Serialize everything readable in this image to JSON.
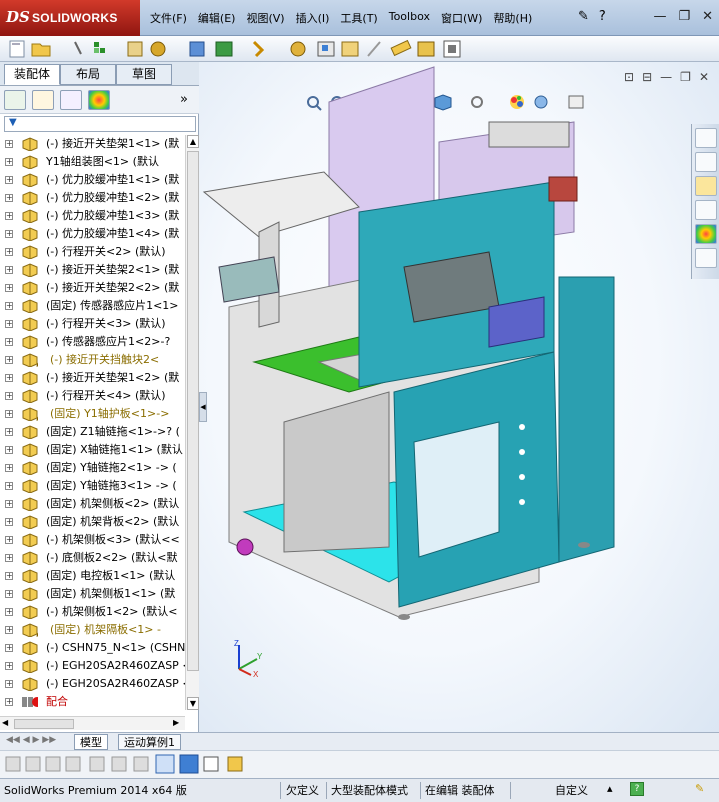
{
  "app": {
    "logo_ds": "DS",
    "logo_name": "SOLIDWORKS"
  },
  "menu": [
    "文件(F)",
    "编辑(E)",
    "视图(V)",
    "插入(I)",
    "工具(T)",
    "Toolbox",
    "窗口(W)",
    "帮助(H)"
  ],
  "left_panel": {
    "tabs": [
      "装配体",
      "布局",
      "草图"
    ],
    "tree": [
      {
        "label": "(-) 接近开关垫架1<1> (默",
        "state": "normal"
      },
      {
        "label": "Y1轴组装图<1> (默认",
        "state": "normal"
      },
      {
        "label": "(-) 优力胶缓冲垫1<1> (默",
        "state": "normal"
      },
      {
        "label": "(-) 优力胶缓冲垫1<2> (默",
        "state": "normal"
      },
      {
        "label": "(-) 优力胶缓冲垫1<3> (默",
        "state": "normal"
      },
      {
        "label": "(-) 优力胶缓冲垫1<4> (默",
        "state": "normal"
      },
      {
        "label": "(-) 行程开关<2> (默认)",
        "state": "normal"
      },
      {
        "label": "(-) 接近开关垫架2<1> (默",
        "state": "normal"
      },
      {
        "label": "(-) 接近开关垫架2<2> (默",
        "state": "normal"
      },
      {
        "label": "(固定) 传感器感应片1<1>",
        "state": "normal"
      },
      {
        "label": "(-) 行程开关<3> (默认)",
        "state": "normal"
      },
      {
        "label": "(-) 传感器感应片1<2>-?",
        "state": "normal"
      },
      {
        "label": "(-) 接近开关挡触块2<",
        "state": "warn"
      },
      {
        "label": "(-) 接近开关垫架1<2> (默",
        "state": "normal"
      },
      {
        "label": "(-) 行程开关<4> (默认)",
        "state": "normal"
      },
      {
        "label": "(固定) Y1轴护板<1>->",
        "state": "warn"
      },
      {
        "label": "(固定) Z1轴链拖<1>->? (",
        "state": "normal"
      },
      {
        "label": "(固定) X轴链拖1<1> (默认",
        "state": "normal"
      },
      {
        "label": "(固定) Y轴链拖2<1> -> (",
        "state": "normal"
      },
      {
        "label": "(固定) Y轴链拖3<1> -> (",
        "state": "normal"
      },
      {
        "label": "(固定) 机架侧板<2> (默认",
        "state": "normal"
      },
      {
        "label": "(固定) 机架背板<2> (默认",
        "state": "normal"
      },
      {
        "label": "(-) 机架侧板<3> (默认<<",
        "state": "normal"
      },
      {
        "label": "(-) 底侧板2<2> (默认<默",
        "state": "normal"
      },
      {
        "label": "(固定) 电控板1<1> (默认",
        "state": "normal"
      },
      {
        "label": "(固定) 机架侧板1<1> (默",
        "state": "normal"
      },
      {
        "label": "(-) 机架侧板1<2> (默认<",
        "state": "normal"
      },
      {
        "label": "(固定) 机架隔板<1> -",
        "state": "warn"
      },
      {
        "label": "(-) CSHN75_N<1> (CSHN75",
        "state": "normal"
      },
      {
        "label": "(-) EGH20SA2R460ZASP <1",
        "state": "normal"
      },
      {
        "label": "(-) EGH20SA2R460ZASP <2",
        "state": "normal"
      },
      {
        "label": "配合",
        "state": "red"
      }
    ]
  },
  "bottom_tabs": [
    "模型",
    "运动算例1"
  ],
  "status": {
    "product": "SolidWorks Premium 2014 x64 版",
    "definition": "欠定义",
    "mode": "大型装配体模式",
    "editing": "在编辑 装配体",
    "units": "自定义"
  },
  "triad": {
    "x": "X",
    "y": "Y",
    "z": "Z"
  },
  "colors": {
    "teal_panel": "#27a2b3",
    "lilac_panel": "#d7c8ec",
    "green_plate": "#3bbf2d",
    "frame_grey": "#cfcfcf",
    "status_bar": "#e4e9f0"
  }
}
